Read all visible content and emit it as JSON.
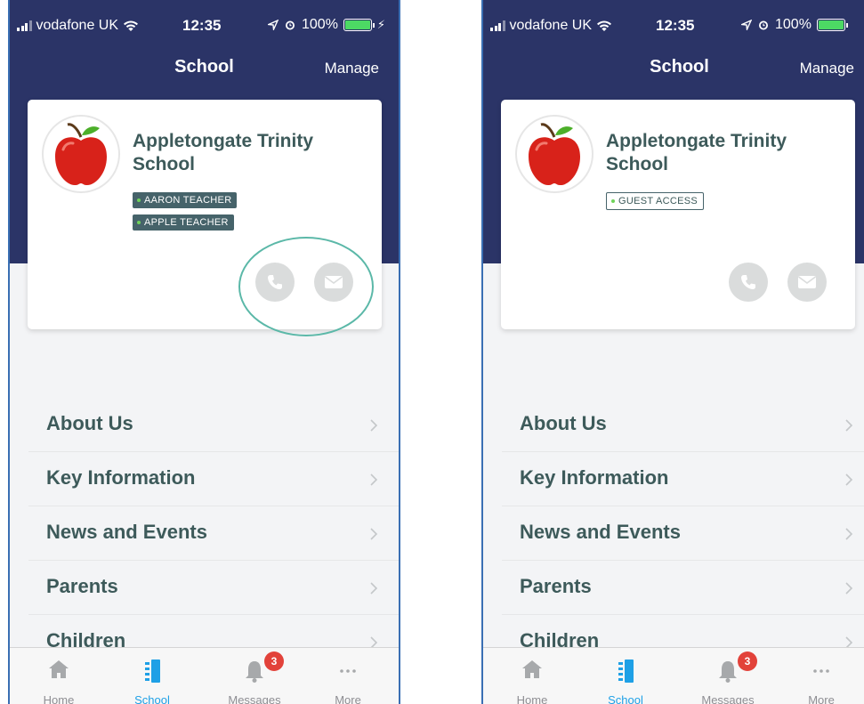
{
  "colors": {
    "header": "#2b3467",
    "accent_tab": "#1ea0e6",
    "badge_red": "#e2423a",
    "text_teal": "#3d5a5a",
    "highlight": "#5bb8a8"
  },
  "left": {
    "status": {
      "carrier": "vodafone UK",
      "time": "12:35",
      "battery": "100%"
    },
    "nav": {
      "title": "School",
      "action": "Manage"
    },
    "school": {
      "name": "Appletongate Trinity School",
      "badges": [
        "AARON TEACHER",
        "APPLE TEACHER"
      ]
    },
    "menu": [
      "About Us",
      "Key Information",
      "News and Events",
      "Parents",
      "Children"
    ],
    "tabs": {
      "home": "Home",
      "school": "School",
      "messages": "Messages",
      "more": "More",
      "messages_badge": "3"
    }
  },
  "right": {
    "status": {
      "carrier": "vodafone UK",
      "time": "12:35",
      "battery": "100%"
    },
    "nav": {
      "title": "School",
      "action": "Manage"
    },
    "school": {
      "name": "Appletongate Trinity School",
      "badges": [
        "GUEST ACCESS"
      ]
    },
    "menu": [
      "About Us",
      "Key Information",
      "News and Events",
      "Parents",
      "Children"
    ],
    "tabs": {
      "home": "Home",
      "school": "School",
      "messages": "Messages",
      "more": "More",
      "messages_badge": "3"
    }
  }
}
